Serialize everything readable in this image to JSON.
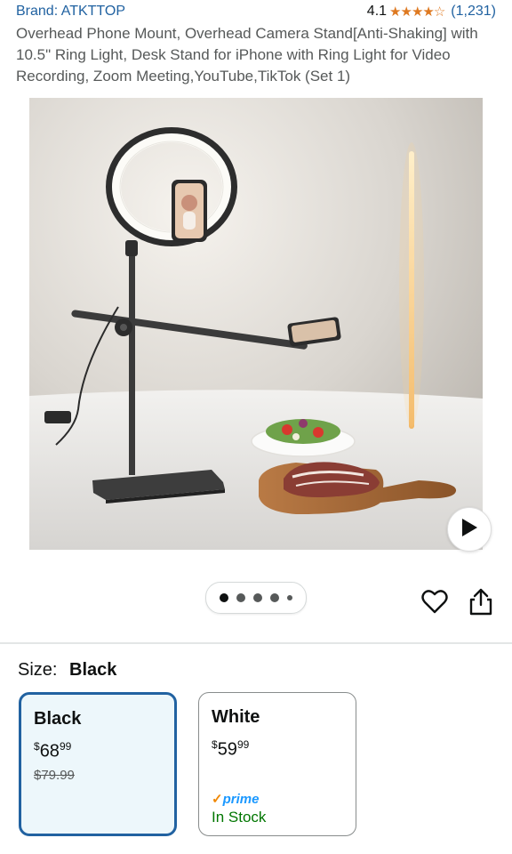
{
  "header": {
    "brand": "Brand: ATKTTOP",
    "rating_value": "4.1",
    "stars": "★★★★☆",
    "rating_count": "(1,231)"
  },
  "product": {
    "title": "Overhead Phone Mount, Overhead Camera Stand[Anti-Shaking] with 10.5\" Ring Light, Desk Stand for iPhone with Ring Light for Video Recording, Zoom Meeting,YouTube,TikTok (Set 1)"
  },
  "gallery": {
    "image_count": 5,
    "active_index": 0
  },
  "size": {
    "label": "Size:",
    "selected": "Black"
  },
  "options": [
    {
      "name": "Black",
      "price_symbol": "$",
      "price_whole": "68",
      "price_fraction": "99",
      "list_price": "$79.99"
    },
    {
      "name": "White",
      "price_symbol": "$",
      "price_whole": "59",
      "price_fraction": "99",
      "prime_check": "✓",
      "prime_label": "prime",
      "stock": "In Stock"
    }
  ],
  "colors": {
    "link": "#2162a1",
    "star": "#de7921",
    "selected_border": "#2162a1",
    "selected_bg": "#edf7fb",
    "in_stock": "#007600",
    "prime": "#1a98ff"
  },
  "icons": [
    "play-icon",
    "heart-icon",
    "share-icon"
  ]
}
